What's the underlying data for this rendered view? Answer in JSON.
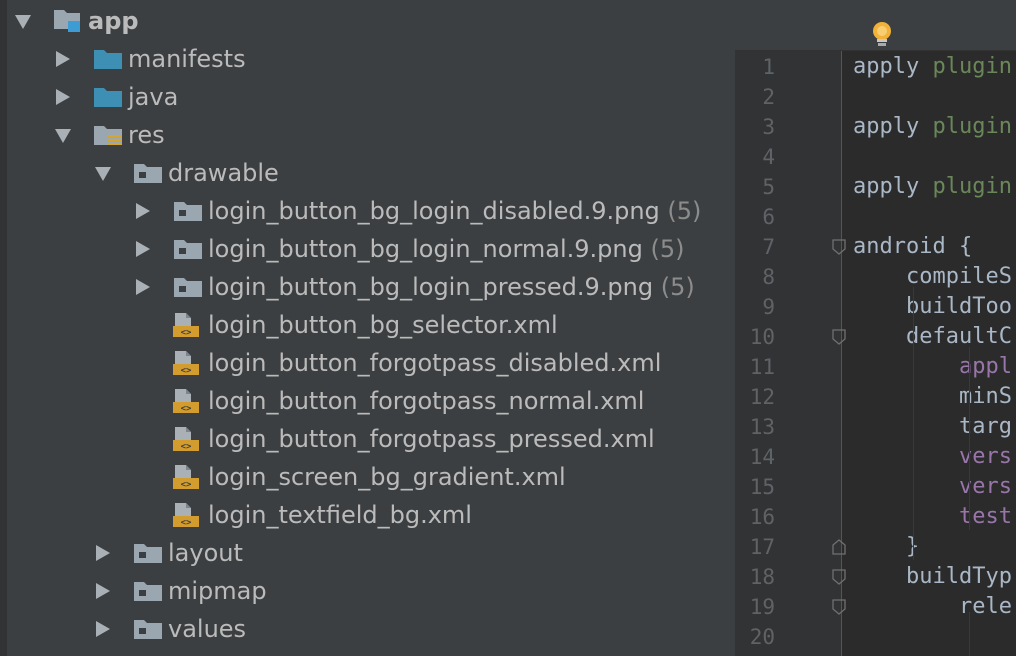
{
  "tree": {
    "rows": [
      {
        "label": "app",
        "count": "",
        "icon": "module-folder-icon",
        "arrow": "down",
        "bold": true
      },
      {
        "label": "manifests",
        "count": "",
        "icon": "folder-icon",
        "arrow": "right",
        "bold": false
      },
      {
        "label": "java",
        "count": "",
        "icon": "folder-icon",
        "arrow": "right",
        "bold": false
      },
      {
        "label": "res",
        "count": "",
        "icon": "resource-folder-icon",
        "arrow": "down",
        "bold": false
      },
      {
        "label": "drawable",
        "count": "",
        "icon": "gray-folder-icon",
        "arrow": "down",
        "bold": false
      },
      {
        "label": "login_button_bg_login_disabled.9.png",
        "count": "(5)",
        "icon": "gray-folder-icon",
        "arrow": "right",
        "bold": false
      },
      {
        "label": "login_button_bg_login_normal.9.png",
        "count": "(5)",
        "icon": "gray-folder-icon",
        "arrow": "right",
        "bold": false
      },
      {
        "label": "login_button_bg_login_pressed.9.png",
        "count": "(5)",
        "icon": "gray-folder-icon",
        "arrow": "right",
        "bold": false
      },
      {
        "label": "login_button_bg_selector.xml",
        "count": "",
        "icon": "xml-file-icon",
        "arrow": "",
        "bold": false
      },
      {
        "label": "login_button_forgotpass_disabled.xml",
        "count": "",
        "icon": "xml-file-icon",
        "arrow": "",
        "bold": false
      },
      {
        "label": "login_button_forgotpass_normal.xml",
        "count": "",
        "icon": "xml-file-icon",
        "arrow": "",
        "bold": false
      },
      {
        "label": "login_button_forgotpass_pressed.xml",
        "count": "",
        "icon": "xml-file-icon",
        "arrow": "",
        "bold": false
      },
      {
        "label": "login_screen_bg_gradient.xml",
        "count": "",
        "icon": "xml-file-icon",
        "arrow": "",
        "bold": false
      },
      {
        "label": "login_textfield_bg.xml",
        "count": "",
        "icon": "xml-file-icon",
        "arrow": "",
        "bold": false
      },
      {
        "label": "layout",
        "count": "",
        "icon": "gray-folder-icon",
        "arrow": "right",
        "bold": false
      },
      {
        "label": "mipmap",
        "count": "",
        "icon": "gray-folder-icon",
        "arrow": "right",
        "bold": false
      },
      {
        "label": "values",
        "count": "",
        "icon": "gray-folder-icon",
        "arrow": "right",
        "bold": false
      }
    ]
  },
  "editor": {
    "intention_icon": "lightbulb-icon",
    "lines": [
      {
        "num": "1",
        "tokens": [
          {
            "t": "apply ",
            "c": "plain"
          },
          {
            "t": "plugin",
            "c": "green"
          }
        ]
      },
      {
        "num": "2",
        "tokens": []
      },
      {
        "num": "3",
        "tokens": [
          {
            "t": "apply ",
            "c": "plain"
          },
          {
            "t": "plugin",
            "c": "green"
          }
        ]
      },
      {
        "num": "4",
        "tokens": []
      },
      {
        "num": "5",
        "tokens": [
          {
            "t": "apply ",
            "c": "plain"
          },
          {
            "t": "plugin",
            "c": "green"
          }
        ]
      },
      {
        "num": "6",
        "tokens": []
      },
      {
        "num": "7",
        "tokens": [
          {
            "t": "android {",
            "c": "plain"
          }
        ]
      },
      {
        "num": "8",
        "tokens": [
          {
            "t": "    compileS",
            "c": "plain"
          }
        ]
      },
      {
        "num": "9",
        "tokens": [
          {
            "t": "    buildToo",
            "c": "plain"
          }
        ]
      },
      {
        "num": "10",
        "tokens": [
          {
            "t": "    defaultC",
            "c": "plain"
          }
        ]
      },
      {
        "num": "11",
        "tokens": [
          {
            "t": "        ",
            "c": "plain"
          },
          {
            "t": "appl",
            "c": "purple"
          }
        ]
      },
      {
        "num": "12",
        "tokens": [
          {
            "t": "        minS",
            "c": "plain"
          }
        ]
      },
      {
        "num": "13",
        "tokens": [
          {
            "t": "        targ",
            "c": "plain"
          }
        ]
      },
      {
        "num": "14",
        "tokens": [
          {
            "t": "        ",
            "c": "plain"
          },
          {
            "t": "vers",
            "c": "purple"
          }
        ]
      },
      {
        "num": "15",
        "tokens": [
          {
            "t": "        ",
            "c": "plain"
          },
          {
            "t": "vers",
            "c": "purple"
          }
        ]
      },
      {
        "num": "16",
        "tokens": [
          {
            "t": "        ",
            "c": "plain"
          },
          {
            "t": "test",
            "c": "purple"
          }
        ]
      },
      {
        "num": "17",
        "tokens": [
          {
            "t": "    }",
            "c": "plain"
          }
        ]
      },
      {
        "num": "18",
        "tokens": [
          {
            "t": "    buildTyp",
            "c": "plain"
          }
        ]
      },
      {
        "num": "19",
        "tokens": [
          {
            "t": "        rele",
            "c": "plain"
          }
        ]
      },
      {
        "num": "20",
        "tokens": []
      }
    ]
  },
  "colors": {
    "tree_bg": "#3c3f41",
    "editor_bg": "#2b2b2b",
    "gutter_bg": "#313335",
    "folder_blue": "#3d8fb3",
    "folder_gray": "#9aa7b0",
    "xml_orange": "#d39c2e"
  }
}
